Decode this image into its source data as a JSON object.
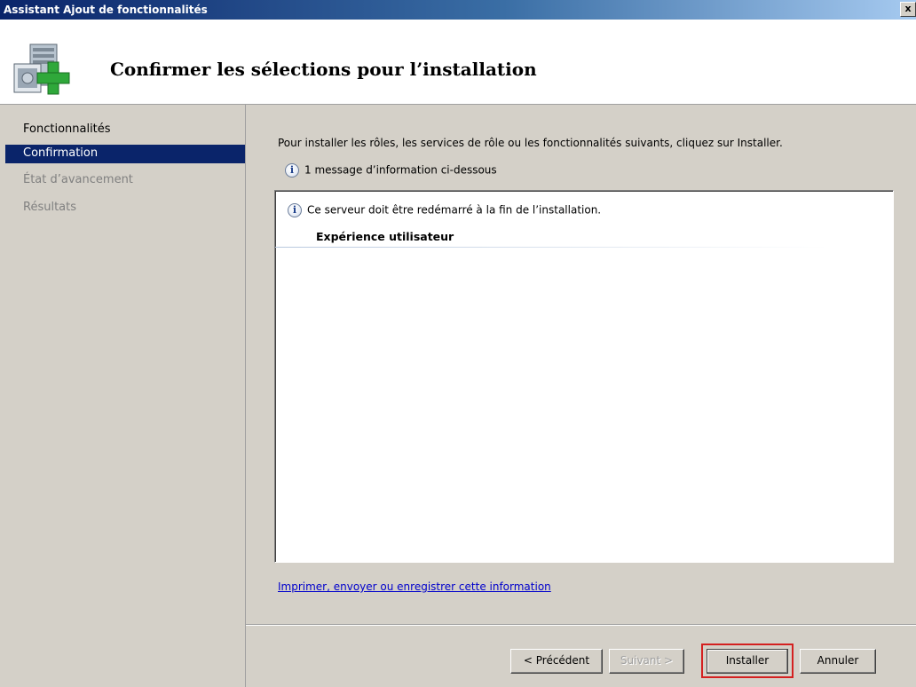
{
  "window": {
    "title": "Assistant Ajout de fonctionnalités",
    "close_label": "x"
  },
  "header": {
    "title": "Confirmer les sélections pour l’installation",
    "icon": "server-add-icon"
  },
  "sidebar": {
    "items": [
      {
        "label": "Fonctionnalités",
        "state": "normal"
      },
      {
        "label": "Confirmation",
        "state": "active"
      },
      {
        "label": "État d’avancement",
        "state": "disabled"
      },
      {
        "label": "Résultats",
        "state": "disabled"
      }
    ]
  },
  "main": {
    "intro": "Pour installer les rôles, les services de rôle ou les fonctionnalités suivants, cliquez sur Installer.",
    "info_summary": "1 message d’information ci-dessous",
    "messages": {
      "restart_notice": "Ce serveur doit être redémarré à la fin de l’installation.",
      "feature_heading": "Expérience utilisateur"
    },
    "link": "Imprimer, envoyer ou enregistrer cette information"
  },
  "buttons": {
    "previous": "< Précédent",
    "next": "Suivant >",
    "install": "Installer",
    "cancel": "Annuler"
  },
  "colors": {
    "selection": "#0a246a",
    "highlight_outline": "#d42020",
    "link": "#0000cc"
  }
}
